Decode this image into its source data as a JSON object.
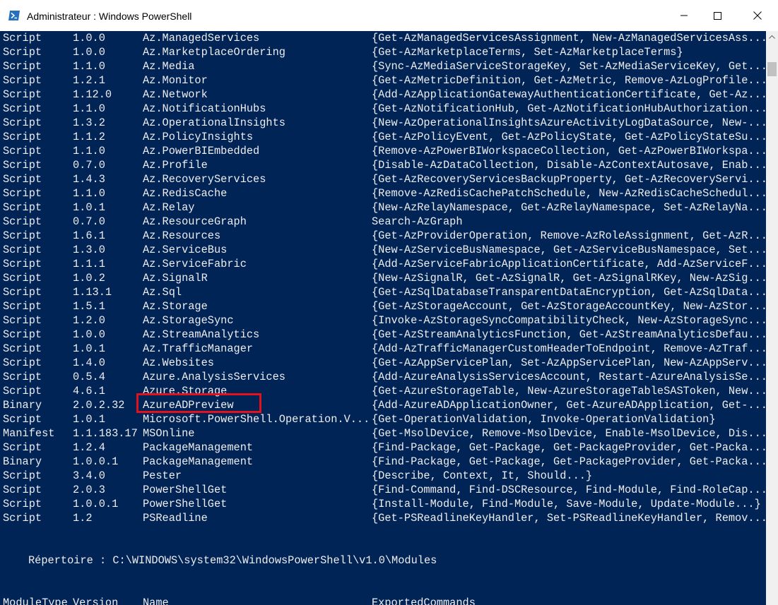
{
  "window": {
    "title": "Administrateur : Windows PowerShell",
    "icons": {
      "app": "powershell-icon",
      "minimize": "minimize-icon",
      "maximize": "maximize-icon",
      "close": "close-icon"
    }
  },
  "colors": {
    "console_bg": "#012456",
    "console_fg": "#eeedf0",
    "highlight": "#e3111b"
  },
  "modules": [
    {
      "type": "Script",
      "version": "1.0.0",
      "name": "Az.ManagedServices",
      "commands": "{Get-AzManagedServicesAssignment, New-AzManagedServicesAss..."
    },
    {
      "type": "Script",
      "version": "1.0.0",
      "name": "Az.MarketplaceOrdering",
      "commands": "{Get-AzMarketplaceTerms, Set-AzMarketplaceTerms}"
    },
    {
      "type": "Script",
      "version": "1.1.0",
      "name": "Az.Media",
      "commands": "{Sync-AzMediaServiceStorageKey, Set-AzMediaServiceKey, Get..."
    },
    {
      "type": "Script",
      "version": "1.2.1",
      "name": "Az.Monitor",
      "commands": "{Get-AzMetricDefinition, Get-AzMetric, Remove-AzLogProfile..."
    },
    {
      "type": "Script",
      "version": "1.12.0",
      "name": "Az.Network",
      "commands": "{Add-AzApplicationGatewayAuthenticationCertificate, Get-Az..."
    },
    {
      "type": "Script",
      "version": "1.1.0",
      "name": "Az.NotificationHubs",
      "commands": "{Get-AzNotificationHub, Get-AzNotificationHubAuthorization..."
    },
    {
      "type": "Script",
      "version": "1.3.2",
      "name": "Az.OperationalInsights",
      "commands": "{New-AzOperationalInsightsAzureActivityLogDataSource, New-..."
    },
    {
      "type": "Script",
      "version": "1.1.2",
      "name": "Az.PolicyInsights",
      "commands": "{Get-AzPolicyEvent, Get-AzPolicyState, Get-AzPolicyStateSu..."
    },
    {
      "type": "Script",
      "version": "1.1.0",
      "name": "Az.PowerBIEmbedded",
      "commands": "{Remove-AzPowerBIWorkspaceCollection, Get-AzPowerBIWorkspa..."
    },
    {
      "type": "Script",
      "version": "0.7.0",
      "name": "Az.Profile",
      "commands": "{Disable-AzDataCollection, Disable-AzContextAutosave, Enab..."
    },
    {
      "type": "Script",
      "version": "1.4.3",
      "name": "Az.RecoveryServices",
      "commands": "{Get-AzRecoveryServicesBackupProperty, Get-AzRecoveryServi..."
    },
    {
      "type": "Script",
      "version": "1.1.0",
      "name": "Az.RedisCache",
      "commands": "{Remove-AzRedisCachePatchSchedule, New-AzRedisCacheSchedul..."
    },
    {
      "type": "Script",
      "version": "1.0.1",
      "name": "Az.Relay",
      "commands": "{New-AzRelayNamespace, Get-AzRelayNamespace, Set-AzRelayNa..."
    },
    {
      "type": "Script",
      "version": "0.7.0",
      "name": "Az.ResourceGraph",
      "commands": "Search-AzGraph"
    },
    {
      "type": "Script",
      "version": "1.6.1",
      "name": "Az.Resources",
      "commands": "{Get-AzProviderOperation, Remove-AzRoleAssignment, Get-AzR..."
    },
    {
      "type": "Script",
      "version": "1.3.0",
      "name": "Az.ServiceBus",
      "commands": "{New-AzServiceBusNamespace, Get-AzServiceBusNamespace, Set..."
    },
    {
      "type": "Script",
      "version": "1.1.1",
      "name": "Az.ServiceFabric",
      "commands": "{Add-AzServiceFabricApplicationCertificate, Add-AzServiceF..."
    },
    {
      "type": "Script",
      "version": "1.0.2",
      "name": "Az.SignalR",
      "commands": "{New-AzSignalR, Get-AzSignalR, Get-AzSignalRKey, New-AzSig..."
    },
    {
      "type": "Script",
      "version": "1.13.1",
      "name": "Az.Sql",
      "commands": "{Get-AzSqlDatabaseTransparentDataEncryption, Get-AzSqlData..."
    },
    {
      "type": "Script",
      "version": "1.5.1",
      "name": "Az.Storage",
      "commands": "{Get-AzStorageAccount, Get-AzStorageAccountKey, New-AzStor..."
    },
    {
      "type": "Script",
      "version": "1.2.0",
      "name": "Az.StorageSync",
      "commands": "{Invoke-AzStorageSyncCompatibilityCheck, New-AzStorageSync..."
    },
    {
      "type": "Script",
      "version": "1.0.0",
      "name": "Az.StreamAnalytics",
      "commands": "{Get-AzStreamAnalyticsFunction, Get-AzStreamAnalyticsDefau..."
    },
    {
      "type": "Script",
      "version": "1.0.1",
      "name": "Az.TrafficManager",
      "commands": "{Add-AzTrafficManagerCustomHeaderToEndpoint, Remove-AzTraf..."
    },
    {
      "type": "Script",
      "version": "1.4.0",
      "name": "Az.Websites",
      "commands": "{Get-AzAppServicePlan, Set-AzAppServicePlan, New-AzAppServ..."
    },
    {
      "type": "Script",
      "version": "0.5.4",
      "name": "Azure.AnalysisServices",
      "commands": "{Add-AzureAnalysisServicesAccount, Restart-AzureAnalysisSe..."
    },
    {
      "type": "Script",
      "version": "4.6.1",
      "name": "Azure.Storage",
      "commands": "{Get-AzureStorageTable, New-AzureStorageTableSASToken, New..."
    },
    {
      "type": "Binary",
      "version": "2.0.2.32",
      "name": "AzureADPreview",
      "commands": "{Add-AzureADApplicationOwner, Get-AzureADApplication, Get-..."
    },
    {
      "type": "Script",
      "version": "1.0.1",
      "name": "Microsoft.PowerShell.Operation.V...",
      "commands": "{Get-OperationValidation, Invoke-OperationValidation}"
    },
    {
      "type": "Manifest",
      "version": "1.1.183.17",
      "name": "MSOnline",
      "commands": "{Get-MsolDevice, Remove-MsolDevice, Enable-MsolDevice, Dis..."
    },
    {
      "type": "Script",
      "version": "1.2.4",
      "name": "PackageManagement",
      "commands": "{Find-Package, Get-Package, Get-PackageProvider, Get-Packa..."
    },
    {
      "type": "Binary",
      "version": "1.0.0.1",
      "name": "PackageManagement",
      "commands": "{Find-Package, Get-Package, Get-PackageProvider, Get-Packa..."
    },
    {
      "type": "Script",
      "version": "3.4.0",
      "name": "Pester",
      "commands": "{Describe, Context, It, Should...}"
    },
    {
      "type": "Script",
      "version": "2.0.3",
      "name": "PowerShellGet",
      "commands": "{Find-Command, Find-DSCResource, Find-Module, Find-RoleCap..."
    },
    {
      "type": "Script",
      "version": "1.0.0.1",
      "name": "PowerShellGet",
      "commands": "{Install-Module, Find-Module, Save-Module, Update-Module...}"
    },
    {
      "type": "Script",
      "version": "1.2",
      "name": "PSReadline",
      "commands": "{Get-PSReadlineKeyHandler, Set-PSReadlineKeyHandler, Remov..."
    }
  ],
  "directory": {
    "label": "Répertoire : C:\\WINDOWS\\system32\\WindowsPowerShell\\v1.0\\Modules"
  },
  "headers": {
    "type": "ModuleType",
    "version": "Version",
    "name": "Name",
    "commands": "ExportedCommands"
  },
  "highlighted_module": "AzureADPreview"
}
